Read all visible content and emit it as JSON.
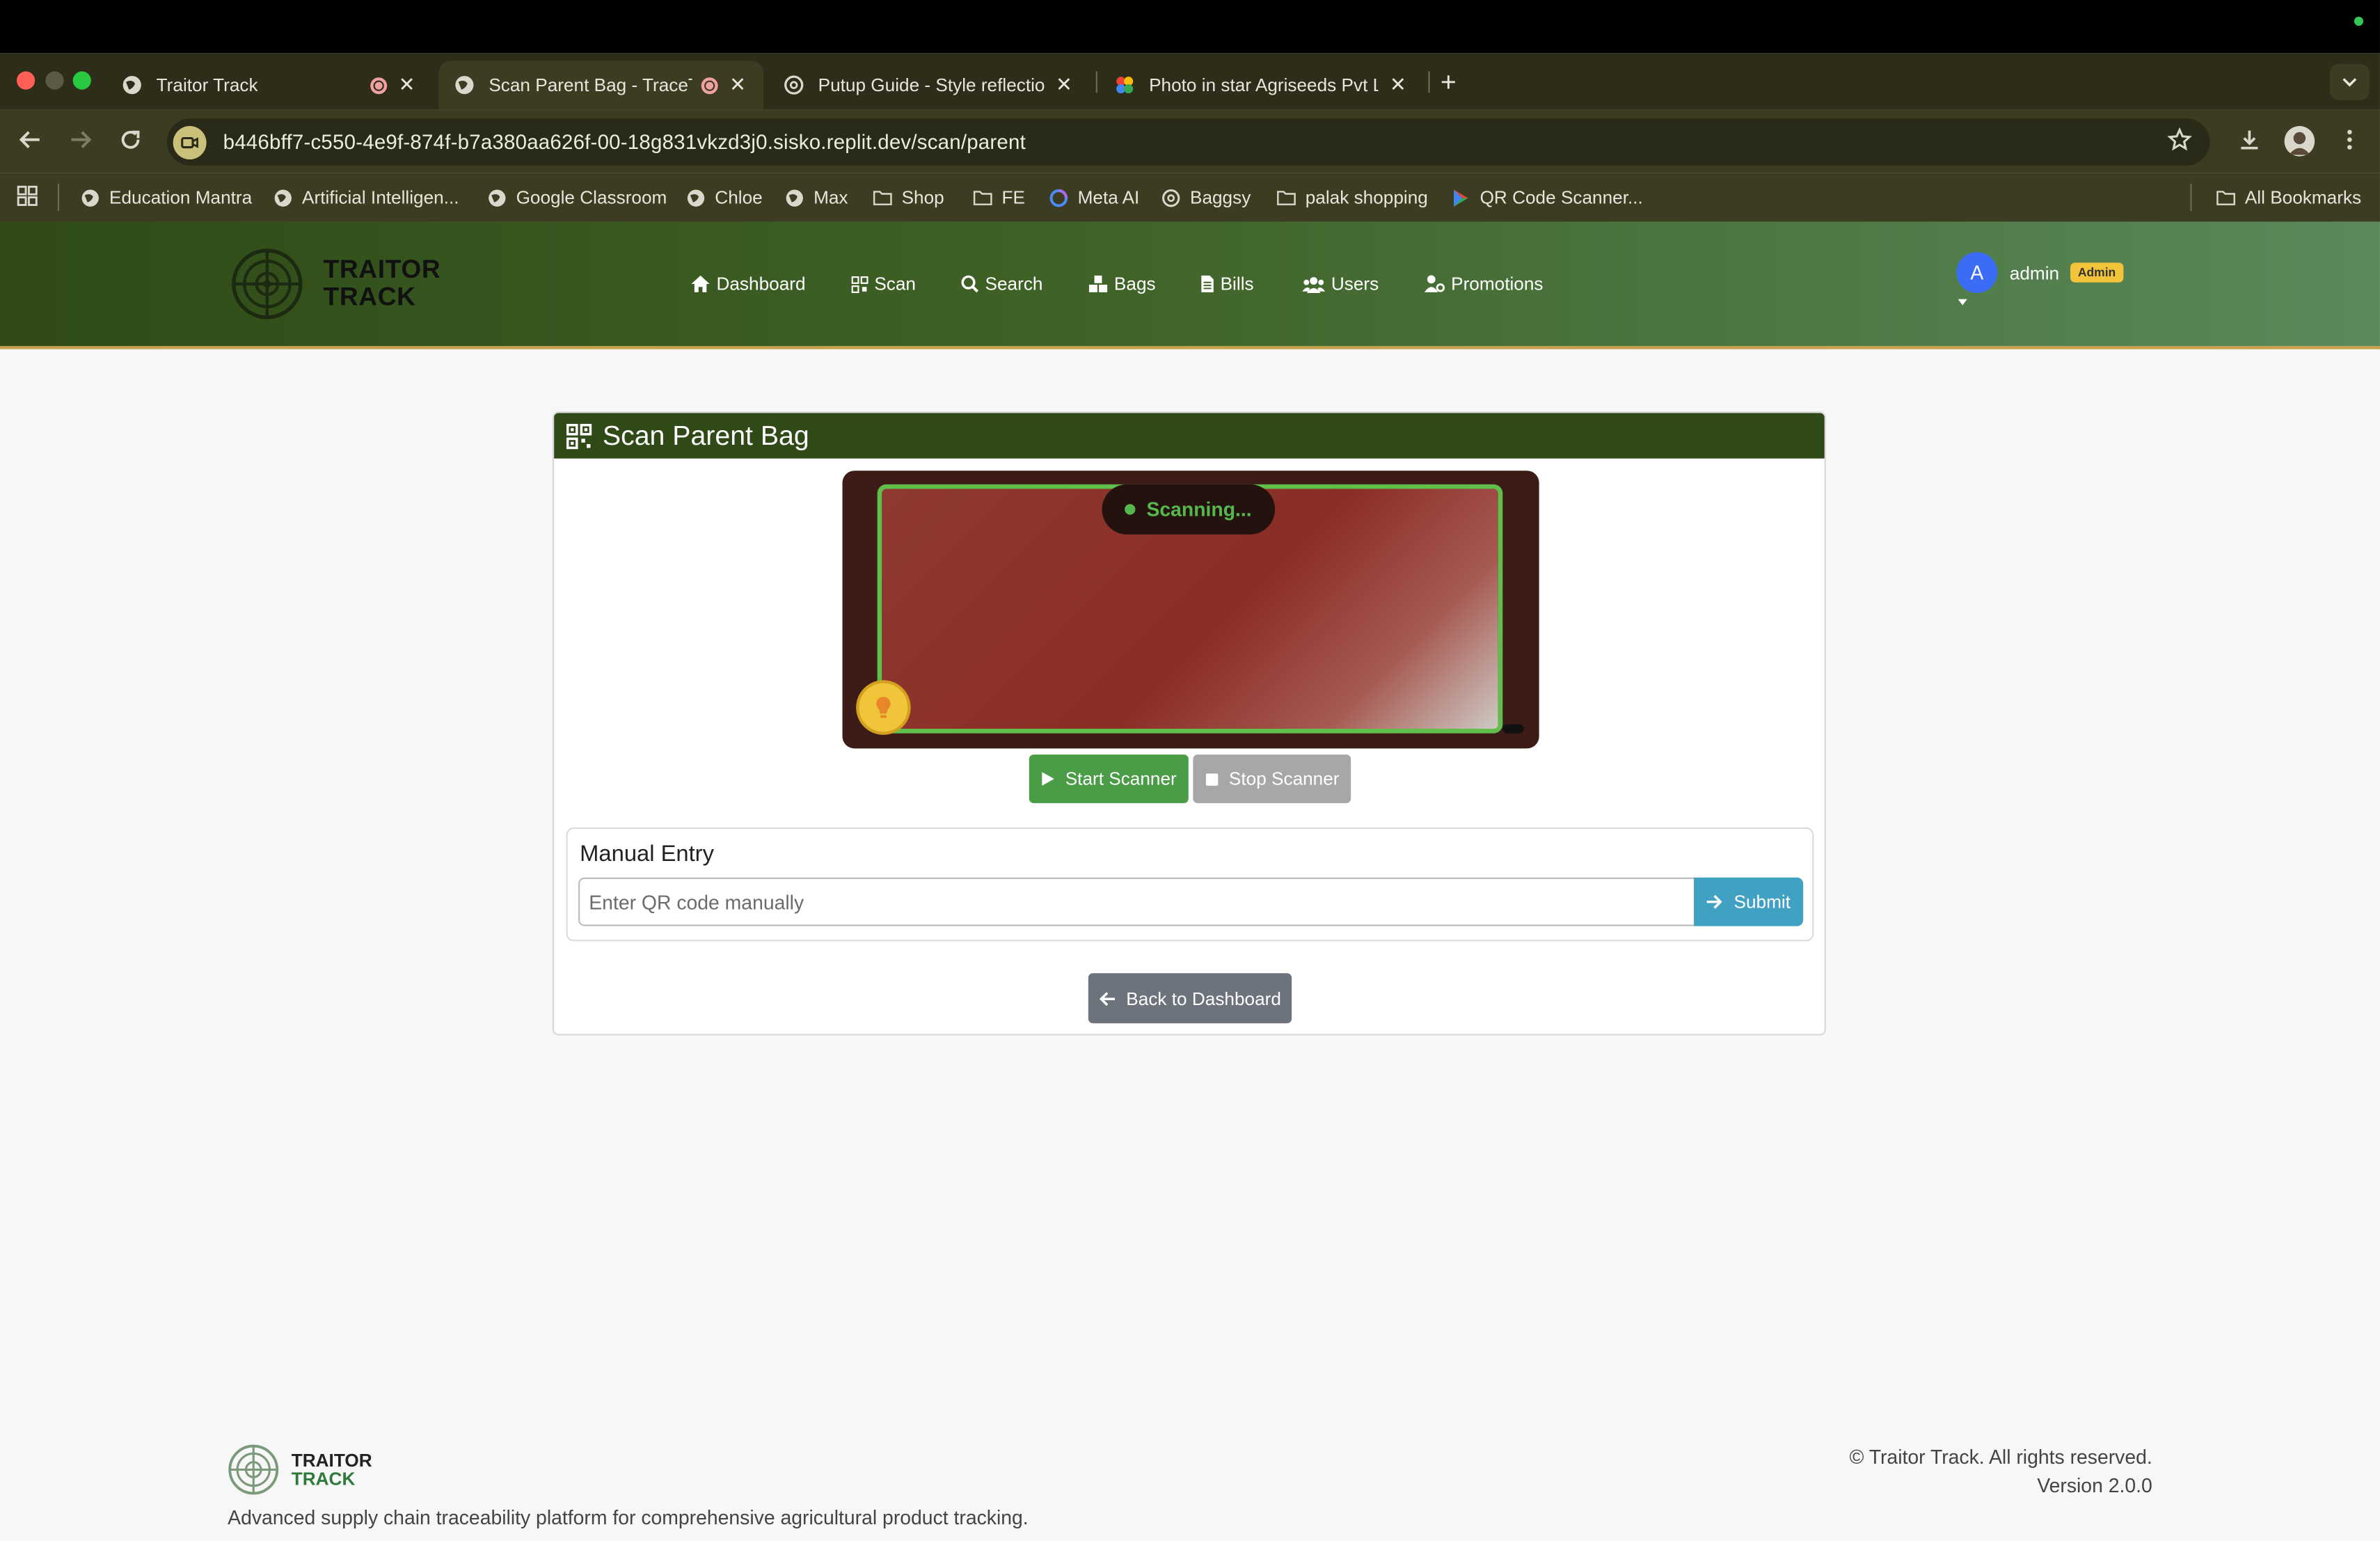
{
  "browser": {
    "tabs": [
      {
        "title": "Traitor Track",
        "active": false,
        "icon": "globe-icon"
      },
      {
        "title": "Scan Parent Bag - TraceTrack",
        "active": true,
        "icon": "globe-icon"
      },
      {
        "title": "Putup Guide - Style reflection",
        "active": false,
        "icon": "openai-icon"
      },
      {
        "title": "Photo in star Agriseeds Pvt Ltd",
        "active": false,
        "icon": "photos-icon"
      }
    ],
    "new_tab_label": "+",
    "url": "b446bff7-c550-4e9f-874f-b7a380aa626f-00-18g831vkzd3j0.sisko.replit.dev/scan/parent",
    "bookmarks": [
      {
        "label": "Education Mantra",
        "icon": "globe-icon"
      },
      {
        "label": "Artificial Intelligen...",
        "icon": "globe-icon"
      },
      {
        "label": "Google Classroom",
        "icon": "globe-icon"
      },
      {
        "label": "Chloe",
        "icon": "globe-icon"
      },
      {
        "label": "Max",
        "icon": "globe-icon"
      },
      {
        "label": "Shop",
        "icon": "folder-icon"
      },
      {
        "label": "FE",
        "icon": "folder-icon"
      },
      {
        "label": "Meta AI",
        "icon": "meta-icon"
      },
      {
        "label": "Baggsy",
        "icon": "openai-icon"
      },
      {
        "label": "palak shopping",
        "icon": "folder-icon"
      },
      {
        "label": "QR Code Scanner...",
        "icon": "play-store-icon"
      }
    ],
    "all_bookmarks_label": "All Bookmarks"
  },
  "app": {
    "brand_line1": "TRAITOR",
    "brand_line2": "TRACK",
    "nav": [
      {
        "label": "Dashboard",
        "icon": "home-icon"
      },
      {
        "label": "Scan",
        "icon": "qr-icon"
      },
      {
        "label": "Search",
        "icon": "search-icon"
      },
      {
        "label": "Bags",
        "icon": "boxes-icon"
      },
      {
        "label": "Bills",
        "icon": "file-icon"
      },
      {
        "label": "Users",
        "icon": "users-icon"
      },
      {
        "label": "Promotions",
        "icon": "user-gear-icon"
      }
    ],
    "user": {
      "initial": "A",
      "name": "admin",
      "role_badge": "Admin"
    },
    "colors": {
      "header_green": "#2f4a17",
      "accent_gold": "#c9a14a",
      "scan_green": "#4a9c47",
      "submit_teal": "#41a1c2"
    }
  },
  "card": {
    "title": "Scan Parent Bag",
    "scanner_status": "Scanning...",
    "start_label": "Start Scanner",
    "stop_label": "Stop Scanner",
    "manual_title": "Manual Entry",
    "manual_placeholder": "Enter QR code manually",
    "submit_label": "Submit",
    "back_label": "Back to Dashboard"
  },
  "footer": {
    "brand_line1": "TRAITOR",
    "brand_line2": "TRACK",
    "description": "Advanced supply chain traceability platform for comprehensive agricultural product tracking.",
    "copyright": "© Traitor Track. All rights reserved.",
    "version": "Version 2.0.0"
  }
}
